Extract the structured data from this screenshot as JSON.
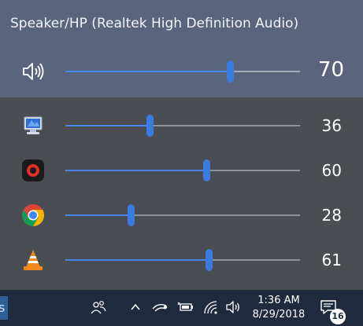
{
  "device": {
    "title": "Speaker/HP (Realtek High Definition Audio)"
  },
  "master": {
    "value": 70,
    "label": "70",
    "icon": "speaker-volume-icon"
  },
  "apps": [
    {
      "name": "system-sounds",
      "icon": "system-sounds-icon",
      "value": 36,
      "label": "36"
    },
    {
      "name": "screen-recorder",
      "icon": "screen-recorder-icon",
      "value": 60,
      "label": "60"
    },
    {
      "name": "chrome",
      "icon": "chrome-icon",
      "value": 28,
      "label": "28"
    },
    {
      "name": "vlc",
      "icon": "vlc-icon",
      "value": 61,
      "label": "61"
    }
  ],
  "taskbar": {
    "time": "1:36 AM",
    "date": "8/29/2018",
    "notification_count": "16",
    "left_app_glyph": "s"
  },
  "colors": {
    "accent": "#3a7be0",
    "flyout_header": "#59657c",
    "flyout_body": "#4a4d52",
    "taskbar": "#1e2a3d"
  }
}
